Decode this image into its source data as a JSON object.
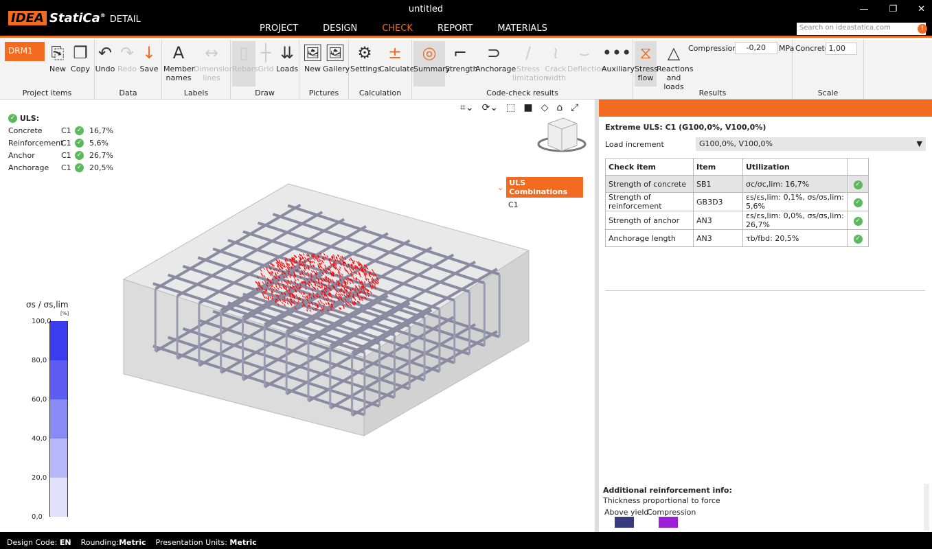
{
  "app": {
    "title": "untitled",
    "logo_brand": "IDEA StatiCa",
    "logo_product": "DETAIL",
    "search_placeholder": "Search on ideastatica.com"
  },
  "menu": [
    "PROJECT",
    "DESIGN",
    "CHECK",
    "REPORT",
    "MATERIALS"
  ],
  "ribbon": {
    "project_item": "DRM1",
    "groups": [
      "Project items",
      "Data",
      "Labels",
      "Draw",
      "Pictures",
      "Calculation",
      "Code-check results",
      "Results",
      "Scale"
    ],
    "buttons": {
      "new": "New",
      "copy": "Copy",
      "undo": "Undo",
      "redo": "Redo",
      "save": "Save",
      "member_names": "Member names",
      "dimension_lines": "Dimension lines",
      "rebars": "Rebars",
      "grid": "Grid",
      "loads": "Loads",
      "pic_new": "New",
      "gallery": "Gallery",
      "settings": "Settings",
      "calculate": "Calculate",
      "summary": "Summary",
      "strength": "Strength",
      "anchorage": "Anchorage",
      "stress_limitation": "Stress limitation",
      "crack_width": "Crack width",
      "deflection": "Deflection",
      "auxiliary": "Auxiliary",
      "stress_flow": "Stress flow",
      "reactions": "Reactions and loads"
    },
    "compression_label": "Compression",
    "compression_value": "-0,20",
    "compression_unit": "MPa",
    "concrete_label": "Concrete",
    "concrete_value": "1,00"
  },
  "uls": {
    "title": "ULS:",
    "rows": [
      {
        "name": "Concrete",
        "comb": "C1",
        "value": "16,7%"
      },
      {
        "name": "Reinforcement",
        "comb": "C1",
        "value": "5,6%"
      },
      {
        "name": "Anchor",
        "comb": "C1",
        "value": "26,7%"
      },
      {
        "name": "Anchorage",
        "comb": "C1",
        "value": "20,5%"
      }
    ]
  },
  "tree": {
    "header": "ULS Combinations",
    "items": [
      "C1"
    ]
  },
  "legend": {
    "title": "σs / σs,lim",
    "unit": "[%]",
    "ticks": [
      "100,0",
      "80,0",
      "60,0",
      "40,0",
      "20,0",
      "0,0"
    ],
    "colors": [
      "#3b3bef",
      "#5c5cf3",
      "#8a8af6",
      "#b7b7f9",
      "#e1e1fc"
    ]
  },
  "panel": {
    "heading": "Extreme ULS: C1 (G100,0%, V100,0%)",
    "load_increment_label": "Load increment",
    "load_increment_value": "G100,0%, V100,0%",
    "columns": [
      "Check item",
      "Item",
      "Utilization",
      ""
    ],
    "rows": [
      {
        "check": "Strength of concrete",
        "item": "SB1",
        "util": "σc/σc,lim: 16,7%",
        "status": "ok"
      },
      {
        "check": "Strength of reinforcement",
        "item": "GB3D3",
        "util": "εs/εs,lim: 0,1%, σs/σs,lim: 5,6%",
        "status": "ok"
      },
      {
        "check": "Strength of anchor",
        "item": "AN3",
        "util": "εs/εs,lim: 0,0%, σs/σs,lim: 26,7%",
        "status": "ok"
      },
      {
        "check": "Anchorage length",
        "item": "AN3",
        "util": "τb/fbd: 20,5%",
        "status": "ok"
      }
    ],
    "info_title": "Additional reinforcement info:",
    "info_sub": "Thickness proportional to force",
    "above_yield": "Above yield",
    "compression": "Compression",
    "above_yield_color": "#363a7e",
    "compression_color": "#9b1fd6"
  },
  "status": {
    "design_code_label": "Design Code:",
    "design_code": "EN",
    "rounding_label": "Rounding:",
    "rounding": "Metric",
    "units_label": "Presentation Units:",
    "units": "Metric"
  }
}
